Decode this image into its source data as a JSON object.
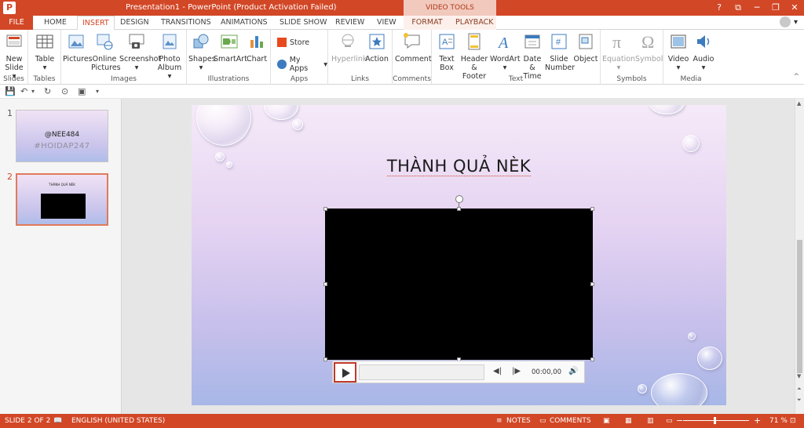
{
  "window": {
    "title": "Presentation1 - PowerPoint (Product Activation Failed)",
    "app_icon": "P",
    "contextual_group": "VIDEO TOOLS",
    "help": "?",
    "ribbon_display": "⧉",
    "minimize": "─",
    "maximize": "❐",
    "close": "✕"
  },
  "tabs": {
    "file": "FILE",
    "home": "HOME",
    "insert": "INSERT",
    "design": "DESIGN",
    "transitions": "TRANSITIONS",
    "animations": "ANIMATIONS",
    "slideshow": "SLIDE SHOW",
    "review": "REVIEW",
    "view": "VIEW",
    "format": "FORMAT",
    "playback": "PLAYBACK"
  },
  "ribbon": {
    "groups": {
      "slides": "Slides",
      "tables": "Tables",
      "images": "Images",
      "illustrations": "Illustrations",
      "apps": "Apps",
      "links": "Links",
      "comments": "Comments",
      "text": "Text",
      "symbols": "Symbols",
      "media": "Media"
    },
    "buttons": {
      "new_slide_1": "New",
      "new_slide_2": "Slide ▾",
      "table_1": "Table",
      "table_2": "▾",
      "pictures": "Pictures",
      "online_pictures_1": "Online",
      "online_pictures_2": "Pictures",
      "screenshot_1": "Screenshot",
      "screenshot_2": "▾",
      "photo_album_1": "Photo",
      "photo_album_2": "Album ▾",
      "shapes_1": "Shapes",
      "shapes_2": "▾",
      "smartart": "SmartArt",
      "chart": "Chart",
      "store": "Store",
      "my_apps": "My Apps",
      "my_apps_arrow": "▾",
      "hyperlink": "Hyperlink",
      "action": "Action",
      "comment": "Comment",
      "text_box_1": "Text",
      "text_box_2": "Box",
      "header_footer_1": "Header",
      "header_footer_2": "& Footer",
      "wordart_1": "WordArt",
      "wordart_2": "▾",
      "date_time_1": "Date &",
      "date_time_2": "Time",
      "slide_number_1": "Slide",
      "slide_number_2": "Number",
      "object": "Object",
      "equation_1": "Equation",
      "equation_2": "▾",
      "symbol": "Symbol",
      "video_1": "Video",
      "video_2": "▾",
      "audio_1": "Audio",
      "audio_2": "▾"
    },
    "collapse": "^"
  },
  "thumbnails": [
    {
      "number": "1",
      "line1": "@NEE484",
      "line2": "#HOIDAP247"
    },
    {
      "number": "2",
      "title": "THÀNH QUẢ NÈK"
    }
  ],
  "slide": {
    "title": "THÀNH QUẢ NÈK"
  },
  "video_controls": {
    "time": "00:00,00"
  },
  "status": {
    "slide_info": "SLIDE 2 OF 2",
    "language": "ENGLISH (UNITED STATES)",
    "notes": "NOTES",
    "comments": "COMMENTS",
    "zoom_minus": "−",
    "zoom_plus": "+",
    "zoom": "71 %"
  },
  "colors": {
    "accent": "#d24726",
    "contextual_tab": "#f1c9bd",
    "slide_top": "#f5eaf8",
    "slide_bottom": "#a7b7e7"
  }
}
